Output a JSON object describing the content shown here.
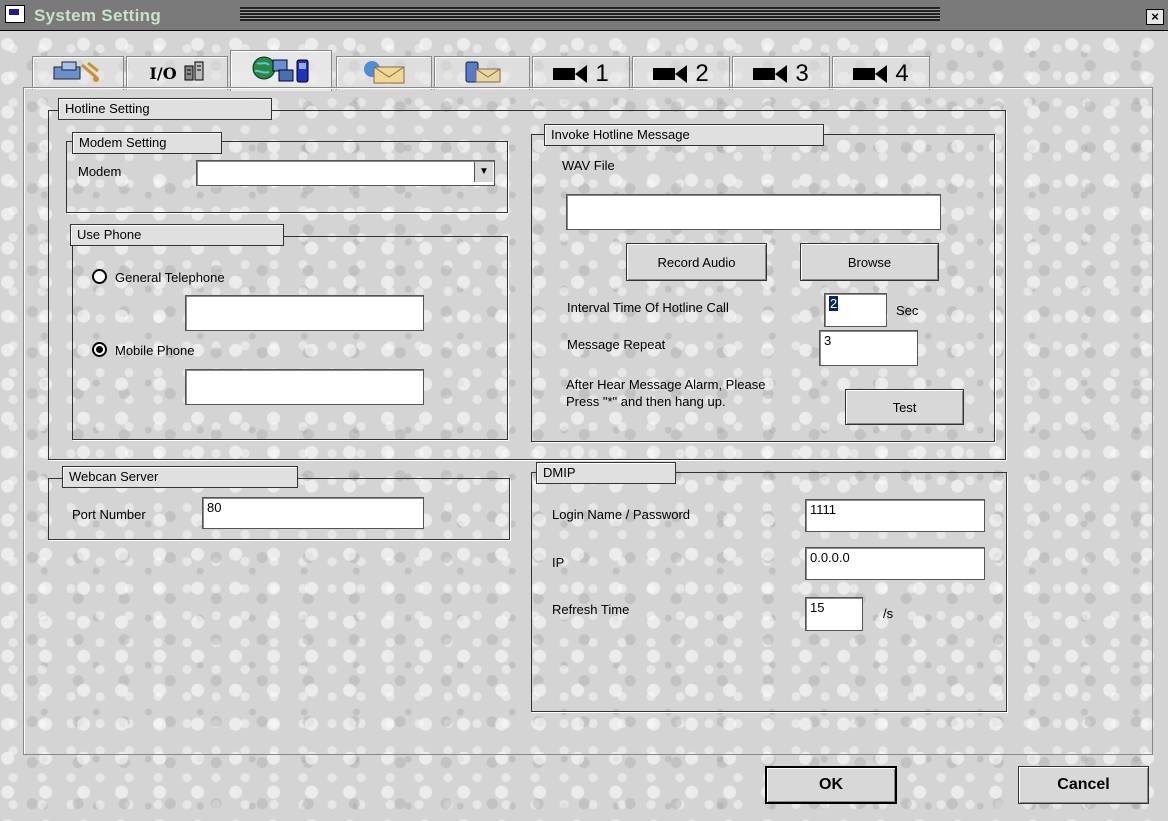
{
  "window": {
    "title": "System Setting",
    "close_glyph": "×"
  },
  "tabs": [
    {
      "icon": "network-icon",
      "label": ""
    },
    {
      "icon": "io-icon",
      "label": "I/O"
    },
    {
      "icon": "globe-phone-icon",
      "label": ""
    },
    {
      "icon": "mail-icon",
      "label": ""
    },
    {
      "icon": "mobile-mail-icon",
      "label": ""
    },
    {
      "icon": "camera-icon",
      "label": "1"
    },
    {
      "icon": "camera-icon",
      "label": "2"
    },
    {
      "icon": "camera-icon",
      "label": "3"
    },
    {
      "icon": "camera-icon",
      "label": "4"
    }
  ],
  "active_tab": 2,
  "hotline": {
    "title": "Hotline Setting",
    "modem": {
      "group_title": "Modem Setting",
      "label": "Modem",
      "value": ""
    },
    "use_phone": {
      "group_title": "Use Phone",
      "general_label": "General Telephone",
      "general_value": "",
      "mobile_label": "Mobile Phone",
      "mobile_value": "",
      "selected": "mobile"
    },
    "invoke": {
      "group_title": "Invoke Hotline Message",
      "wav_label": "WAV File",
      "wav_value": "",
      "record_button": "Record Audio",
      "browse_button": "Browse",
      "interval_label": "Interval Time Of Hotline Call",
      "interval_value": "2",
      "interval_unit": "Sec",
      "repeat_label": "Message Repeat",
      "repeat_value": "3",
      "hint_line1": "After Hear Message Alarm, Please",
      "hint_line2": "Press \"*\" and then hang up.",
      "test_button": "Test"
    }
  },
  "webcam": {
    "title": "Webcan Server",
    "port_label": "Port Number",
    "port_value": "80"
  },
  "dmip": {
    "title": "DMIP",
    "login_label": "Login Name / Password",
    "login_value": "1111",
    "ip_label": "IP",
    "ip_value": "0.0.0.0",
    "refresh_label": "Refresh Time",
    "refresh_value": "15",
    "refresh_unit": "/s"
  },
  "footer": {
    "ok": "OK",
    "cancel": "Cancel"
  }
}
